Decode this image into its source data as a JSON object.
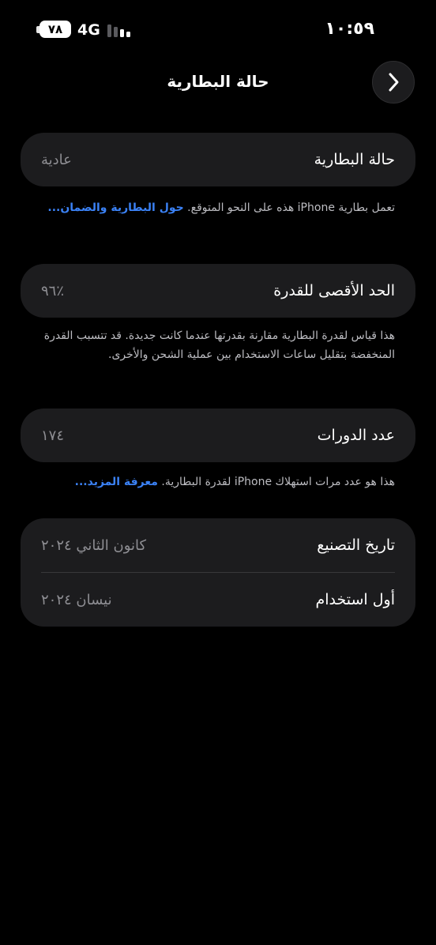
{
  "status_bar": {
    "time": "١٠:٥٩",
    "network": "4G",
    "battery_level": "٧٨"
  },
  "nav": {
    "title": "حالة البطارية"
  },
  "battery_health": {
    "label": "حالة البطارية",
    "value": "عادية",
    "note_text": "تعمل بطارية iPhone هذه على النحو المتوقع. ",
    "note_link": "حول البطارية والضمان..."
  },
  "max_capacity": {
    "label": "الحد الأقصى للقدرة",
    "value": "٪٩٦",
    "note_text": "هذا قياس لقدرة البطارية مقارنة بقدرتها عندما كانت جديدة. قد تتسبب القدرة المنخفضة بتقليل ساعات الاستخدام بين عملية الشحن والأخرى."
  },
  "cycle_count": {
    "label": "عدد الدورات",
    "value": "١٧٤",
    "note_text": "هذا هو عدد مرات استهلاك iPhone لقدرة البطارية. ",
    "note_link": "معرفة المزيد..."
  },
  "dates": {
    "manufacture_label": "تاريخ التصنيع",
    "manufacture_value": "كانون الثاني ٢٠٢٤",
    "first_use_label": "أول استخدام",
    "first_use_value": "نيسان ٢٠٢٤"
  },
  "colors": {
    "background": "#000000",
    "card": "#1c1c1e",
    "link": "#3b82f6",
    "secondary_text": "#8e8e93"
  }
}
